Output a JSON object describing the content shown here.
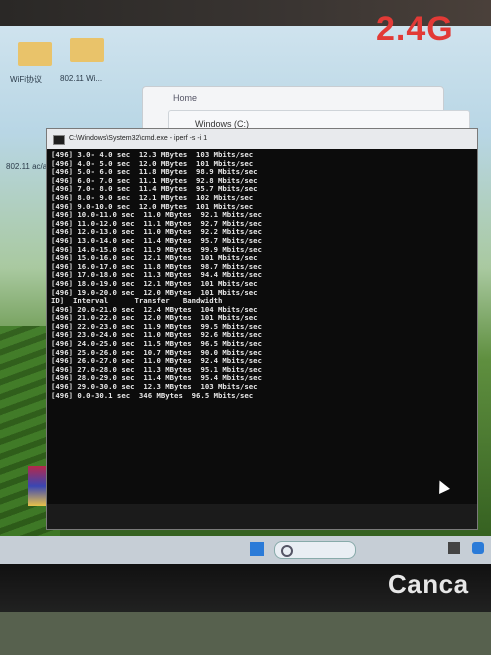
{
  "overlay_title": "2.4G",
  "desktop": {
    "labels": [
      "WiFi协议",
      "802.11 Wi..."
    ],
    "side_label": "802.11 ac/ax"
  },
  "windows": {
    "home_title": "Home",
    "drive_title": "Windows (C:)"
  },
  "cmd": {
    "title": "C:\\Windows\\System32\\cmd.exe - iperf -s -i 1",
    "header": [
      "ID]",
      "Interval",
      "Transfer",
      "Bandwidth"
    ],
    "rows_a": [
      {
        "id": "496]",
        "interval": "3.0- 4.0 sec",
        "transfer": "12.3 MBytes",
        "bandwidth": "103 Mbits/sec"
      },
      {
        "id": "496]",
        "interval": "4.0- 5.0 sec",
        "transfer": "12.0 MBytes",
        "bandwidth": "101 Mbits/sec"
      },
      {
        "id": "496]",
        "interval": "5.0- 6.0 sec",
        "transfer": "11.8 MBytes",
        "bandwidth": "98.9 Mbits/sec"
      },
      {
        "id": "496]",
        "interval": "6.0- 7.0 sec",
        "transfer": "11.1 MBytes",
        "bandwidth": "92.8 Mbits/sec"
      },
      {
        "id": "496]",
        "interval": "7.0- 8.0 sec",
        "transfer": "11.4 MBytes",
        "bandwidth": "95.7 Mbits/sec"
      },
      {
        "id": "496]",
        "interval": "8.0- 9.0 sec",
        "transfer": "12.1 MBytes",
        "bandwidth": "102 Mbits/sec"
      },
      {
        "id": "496]",
        "interval": "9.0-10.0 sec",
        "transfer": "12.0 MBytes",
        "bandwidth": "101 Mbits/sec"
      },
      {
        "id": "496]",
        "interval": "10.0-11.0 sec",
        "transfer": "11.0 MBytes",
        "bandwidth": "92.1 Mbits/sec"
      },
      {
        "id": "496]",
        "interval": "11.0-12.0 sec",
        "transfer": "11.1 MBytes",
        "bandwidth": "92.7 Mbits/sec"
      },
      {
        "id": "496]",
        "interval": "12.0-13.0 sec",
        "transfer": "11.0 MBytes",
        "bandwidth": "92.2 Mbits/sec"
      },
      {
        "id": "496]",
        "interval": "13.0-14.0 sec",
        "transfer": "11.4 MBytes",
        "bandwidth": "95.7 Mbits/sec"
      },
      {
        "id": "496]",
        "interval": "14.0-15.0 sec",
        "transfer": "11.9 MBytes",
        "bandwidth": "99.9 Mbits/sec"
      },
      {
        "id": "496]",
        "interval": "15.0-16.0 sec",
        "transfer": "12.1 MBytes",
        "bandwidth": "101 Mbits/sec"
      },
      {
        "id": "496]",
        "interval": "16.0-17.0 sec",
        "transfer": "11.8 MBytes",
        "bandwidth": "98.7 Mbits/sec"
      },
      {
        "id": "496]",
        "interval": "17.0-18.0 sec",
        "transfer": "11.3 MBytes",
        "bandwidth": "94.4 Mbits/sec"
      },
      {
        "id": "496]",
        "interval": "18.0-19.0 sec",
        "transfer": "12.1 MBytes",
        "bandwidth": "101 Mbits/sec"
      },
      {
        "id": "496]",
        "interval": "19.0-20.0 sec",
        "transfer": "12.0 MBytes",
        "bandwidth": "101 Mbits/sec"
      }
    ],
    "rows_b": [
      {
        "id": "496]",
        "interval": "20.0-21.0 sec",
        "transfer": "12.4 MBytes",
        "bandwidth": "104 Mbits/sec"
      },
      {
        "id": "496]",
        "interval": "21.0-22.0 sec",
        "transfer": "12.0 MBytes",
        "bandwidth": "101 Mbits/sec"
      },
      {
        "id": "496]",
        "interval": "22.0-23.0 sec",
        "transfer": "11.9 MBytes",
        "bandwidth": "99.5 Mbits/sec"
      },
      {
        "id": "496]",
        "interval": "23.0-24.0 sec",
        "transfer": "11.0 MBytes",
        "bandwidth": "92.6 Mbits/sec"
      },
      {
        "id": "496]",
        "interval": "24.0-25.0 sec",
        "transfer": "11.5 MBytes",
        "bandwidth": "96.5 Mbits/sec"
      },
      {
        "id": "496]",
        "interval": "25.0-26.0 sec",
        "transfer": "10.7 MBytes",
        "bandwidth": "90.0 Mbits/sec"
      },
      {
        "id": "496]",
        "interval": "26.0-27.0 sec",
        "transfer": "11.0 MBytes",
        "bandwidth": "92.4 Mbits/sec"
      },
      {
        "id": "496]",
        "interval": "27.0-28.0 sec",
        "transfer": "11.3 MBytes",
        "bandwidth": "95.1 Mbits/sec"
      },
      {
        "id": "496]",
        "interval": "28.0-29.0 sec",
        "transfer": "11.4 MBytes",
        "bandwidth": "95.4 Mbits/sec"
      },
      {
        "id": "496]",
        "interval": "29.0-30.0 sec",
        "transfer": "12.3 MBytes",
        "bandwidth": "103 Mbits/sec"
      },
      {
        "id": "496]",
        "interval": "0.0-30.1 sec",
        "transfer": "346 MBytes",
        "bandwidth": "96.5 Mbits/sec"
      }
    ]
  },
  "taskbar": {
    "search_text": "Search"
  },
  "monitor_brand": "Canca"
}
